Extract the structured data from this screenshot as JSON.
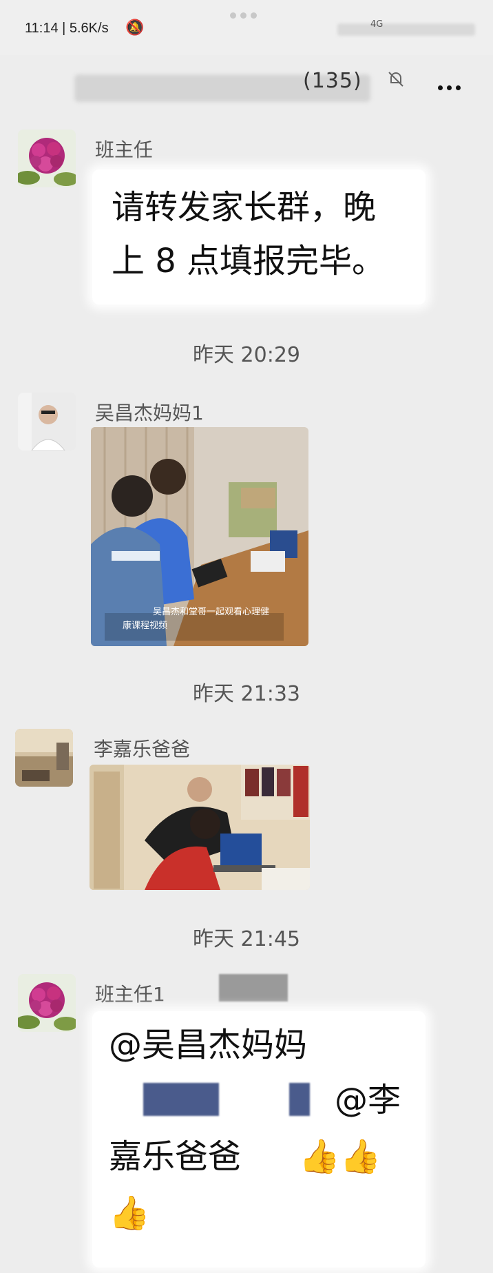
{
  "status_bar": {
    "time": "11:14 | 5.6K/s",
    "network": "4G"
  },
  "title_bar": {
    "member_count": "(135)"
  },
  "messages": [
    {
      "sender": "班主任",
      "lines": [
        "请转发家长群，晚",
        "上 8 点填报完毕。"
      ]
    },
    {
      "timestamp": "昨天 20:29"
    },
    {
      "sender": "吴昌杰妈妈1",
      "caption_1": "吴昌杰和堂哥一起观看心理健",
      "caption_2": "康课程视频"
    },
    {
      "timestamp": "昨天 21:33"
    },
    {
      "sender": "李嘉乐爸爸"
    },
    {
      "timestamp": "昨天 21:45"
    },
    {
      "sender": "班主任1",
      "line_1": "@吴昌杰妈妈",
      "line_2": "@李",
      "line_3": "嘉乐爸爸",
      "thumbs": "👍👍",
      "thumb_3": "👍"
    }
  ],
  "colors": {
    "background": "#ededed",
    "bubble": "#ffffff",
    "blur_block": "#4a5b8c"
  }
}
